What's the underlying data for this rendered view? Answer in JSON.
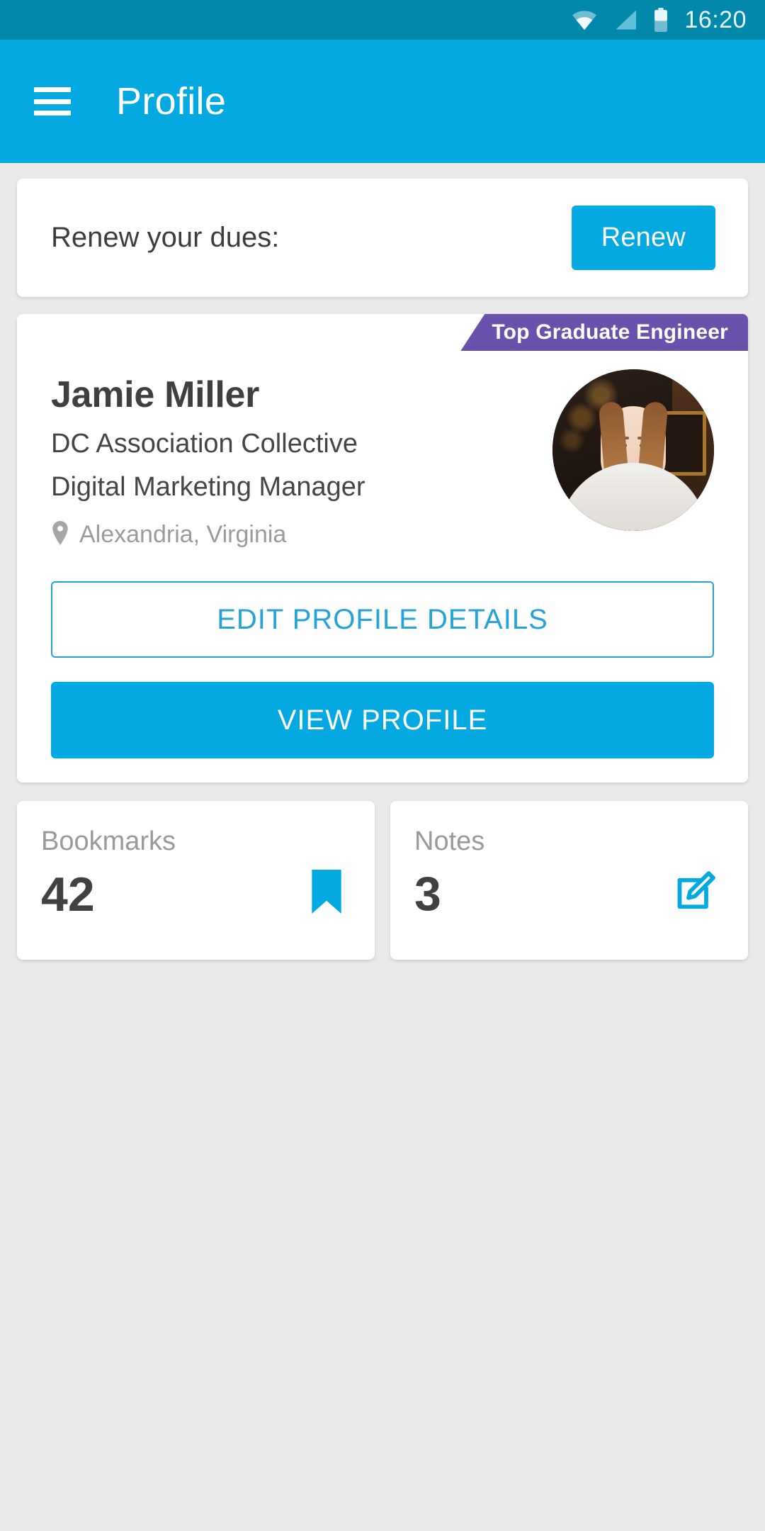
{
  "statusbar": {
    "time": "16:20",
    "icons": [
      "wifi-icon",
      "cellular-signal-icon",
      "battery-icon"
    ]
  },
  "appbar": {
    "menu_icon": "hamburger-menu-icon",
    "title": "Profile"
  },
  "renew_card": {
    "label": "Renew your dues:",
    "button_label": "Renew"
  },
  "profile_card": {
    "ribbon_label": "Top Graduate Engineer",
    "name": "Jamie Miller",
    "organization": "DC Association Collective",
    "role": "Digital Marketing Manager",
    "location": "Alexandria, Virginia",
    "location_icon": "map-pin-icon",
    "avatar_alt": "Jamie Miller profile photo",
    "edit_button_label": "EDIT PROFILE DETAILS",
    "view_button_label": "VIEW PROFILE"
  },
  "stats": [
    {
      "label": "Bookmarks",
      "value": "42",
      "icon": "bookmark-icon"
    },
    {
      "label": "Notes",
      "value": "3",
      "icon": "edit-note-icon"
    }
  ],
  "colors": {
    "status_bar": "#0288ab",
    "app_bar": "#03a9e0",
    "accent": "#03a9e0",
    "ribbon": "#6a51ab",
    "page_background": "#eaeaea",
    "card_background": "#ffffff",
    "text_primary": "#3f3f3f",
    "text_muted": "#9a9a9a"
  }
}
